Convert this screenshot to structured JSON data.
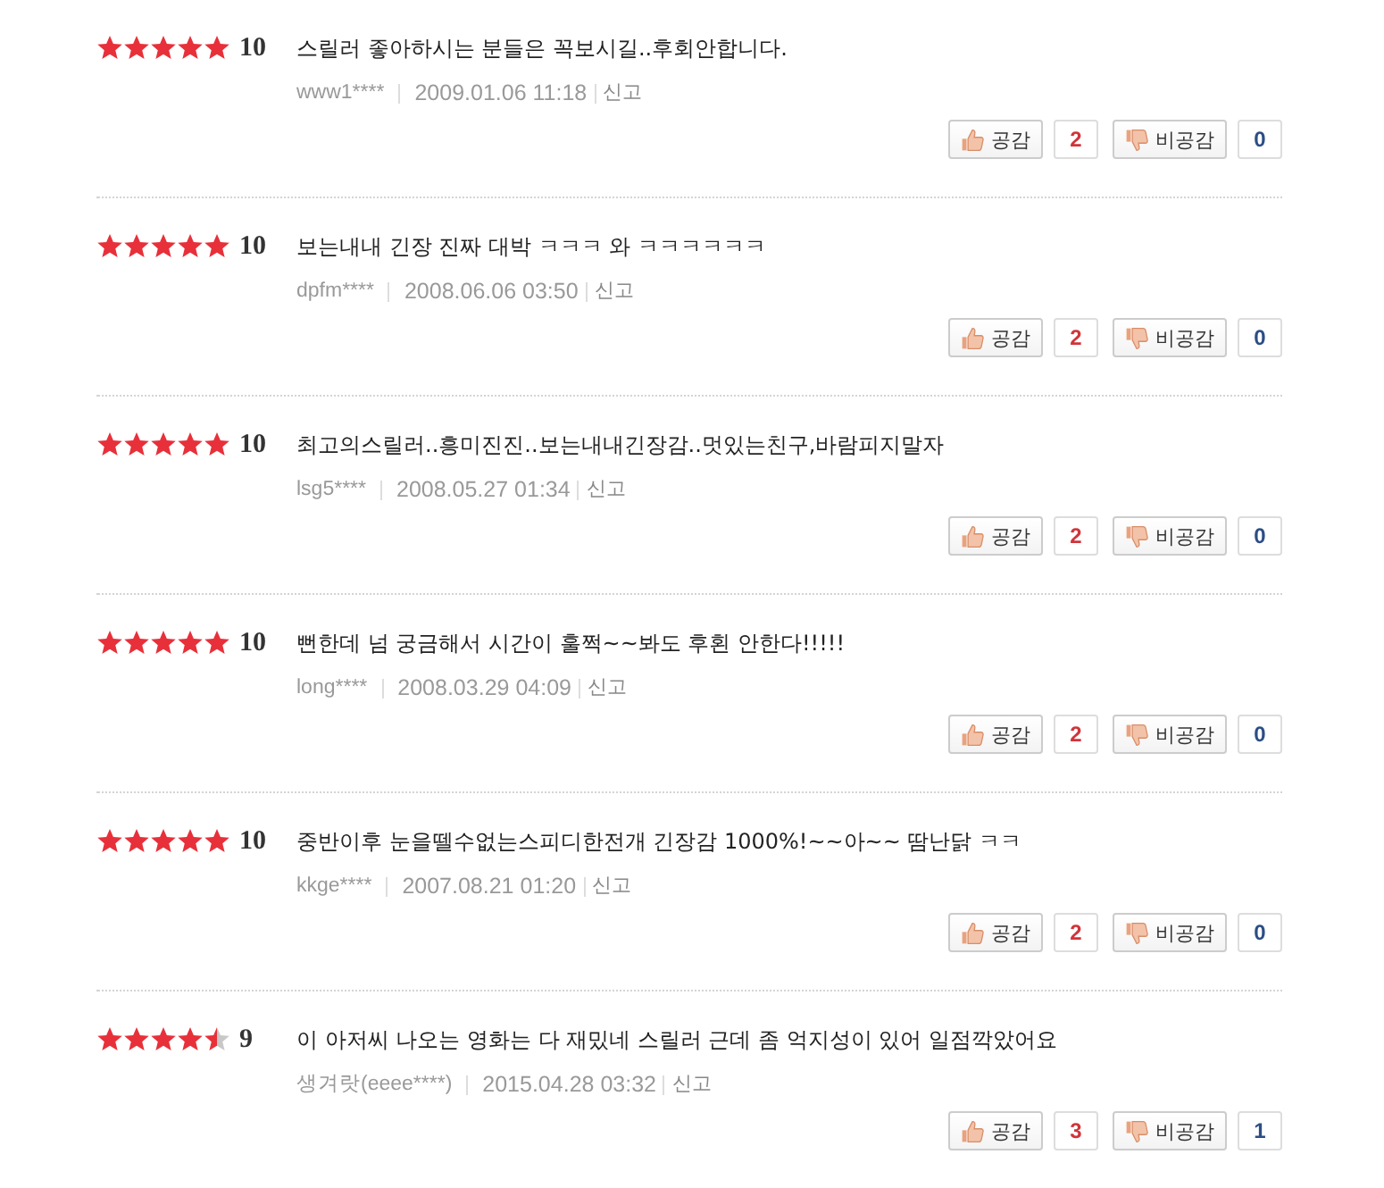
{
  "reviews": [
    {
      "stars": 5,
      "score": "10",
      "text": "스릴러 좋아하시는 분들은 꼭보시길..후회안합니다.",
      "author": "www1****",
      "date": "2009.01.06 11:18",
      "report": "신고",
      "like_label": "공감",
      "likes": "2",
      "dislike_label": "비공감",
      "dislikes": "0"
    },
    {
      "stars": 5,
      "score": "10",
      "text": "보는내내 긴장 진짜 대박 ㅋㅋㅋ 와 ㅋㅋㅋㅋㅋㅋ",
      "author": "dpfm****",
      "date": "2008.06.06 03:50",
      "report": "신고",
      "like_label": "공감",
      "likes": "2",
      "dislike_label": "비공감",
      "dislikes": "0"
    },
    {
      "stars": 5,
      "score": "10",
      "text": "최고의스릴러..흥미진진..보는내내긴장감..멋있는친구,바람피지말자",
      "author": "lsg5****",
      "date": "2008.05.27 01:34",
      "report": "신고",
      "like_label": "공감",
      "likes": "2",
      "dislike_label": "비공감",
      "dislikes": "0"
    },
    {
      "stars": 5,
      "score": "10",
      "text": "뻔한데 넘 궁금해서 시간이 훌쩍~~봐도 후횐 안한다!!!!!",
      "author": "long****",
      "date": "2008.03.29 04:09",
      "report": "신고",
      "like_label": "공감",
      "likes": "2",
      "dislike_label": "비공감",
      "dislikes": "0"
    },
    {
      "stars": 5,
      "score": "10",
      "text": "중반이후 눈을뗄수없는스피디한전개 긴장감 1000%!~~아~~ 땀난닭 ㅋㅋ",
      "author": "kkge****",
      "date": "2007.08.21 01:20",
      "report": "신고",
      "like_label": "공감",
      "likes": "2",
      "dislike_label": "비공감",
      "dislikes": "0"
    },
    {
      "stars": 4.5,
      "score": "9",
      "text": "이 아저씨 나오는 영화는 다 재밌네 스릴러 근데 좀 억지성이 있어 일점깍았어요",
      "author": "생겨랏(eeee****)",
      "date": "2015.04.28 03:32",
      "report": "신고",
      "like_label": "공감",
      "likes": "3",
      "dislike_label": "비공감",
      "dislikes": "1"
    }
  ]
}
